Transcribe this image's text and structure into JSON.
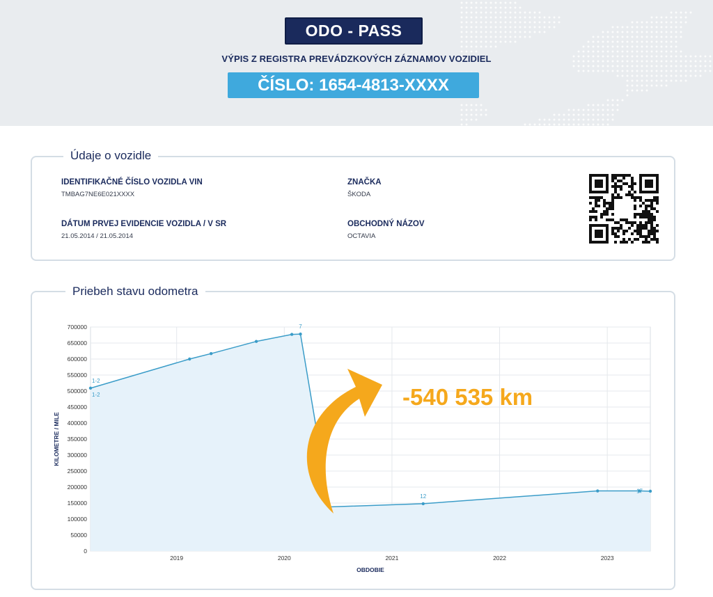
{
  "header": {
    "logo": "ODO - PASS",
    "subtitle": "VÝPIS Z REGISTRA PREVÁDZKOVÝCH ZÁZNAMOV VOZIDIEL",
    "number": "ČÍSLO: 1654-4813-XXXX"
  },
  "vehicle": {
    "section_title": "Údaje o vozidle",
    "vin_label": "IDENTIFIKAČNÉ ČÍSLO VOZIDLA VIN",
    "vin_value": "TMBAG7NE6E021XXXX",
    "date_label": "DÁTUM PRVEJ EVIDENCIE VOZIDLA / V SR",
    "date_value": "21.05.2014 / 21.05.2014",
    "brand_label": "ZNAČKA",
    "brand_value": "ŠKODA",
    "model_label": "OBCHODNÝ NÁZOV",
    "model_value": "OCTAVIA"
  },
  "odometer": {
    "section_title": "Priebeh stavu odometra",
    "annotation": "-540 535 km",
    "accent_color": "#f5a81c"
  },
  "chart_data": {
    "type": "area",
    "xlabel": "OBDOBIE",
    "ylabel": "KILOMETRE / MILE",
    "ylim": [
      0,
      700000
    ],
    "y_ticks": [
      "0",
      "50000",
      "100000",
      "150000",
      "200000",
      "250000",
      "300000",
      "350000",
      "400000",
      "450000",
      "500000",
      "550000",
      "600000",
      "650000",
      "700000"
    ],
    "x_ticks": [
      "2019",
      "2020",
      "2021",
      "2022",
      "2023"
    ],
    "xlim": [
      2018.2,
      2023.4
    ],
    "grid": true,
    "line_color": "#3a9cc8",
    "fill_color": "#e6f2fa",
    "points": [
      {
        "x": 2018.2,
        "y": 509000
      },
      {
        "x": 2019.12,
        "y": 600000
      },
      {
        "x": 2019.32,
        "y": 617000
      },
      {
        "x": 2019.74,
        "y": 655000
      },
      {
        "x": 2020.07,
        "y": 677000
      },
      {
        "x": 2020.15,
        "y": 678000
      },
      {
        "x": 2020.42,
        "y": 138000
      },
      {
        "x": 2021.29,
        "y": 148000
      },
      {
        "x": 2022.91,
        "y": 188000
      },
      {
        "x": 2023.3,
        "y": 188000
      },
      {
        "x": 2023.4,
        "y": 187000
      }
    ],
    "point_labels": [
      {
        "x": 2018.2,
        "y": 509000,
        "text": "1-2",
        "pos": "above"
      },
      {
        "x": 2018.2,
        "y": 509000,
        "text": "1-2",
        "pos": "below"
      },
      {
        "x": 2020.15,
        "y": 678000,
        "text": "7",
        "pos": "above"
      },
      {
        "x": 2021.29,
        "y": 148000,
        "text": "12",
        "pos": "above"
      },
      {
        "x": 2023.3,
        "y": 188000,
        "text": "17",
        "pos": "inline"
      }
    ]
  }
}
